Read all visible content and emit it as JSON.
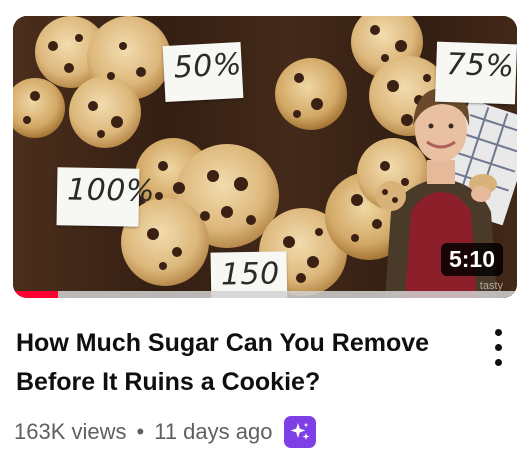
{
  "video": {
    "duration": "5:10",
    "watch_progress": 0.09,
    "watermark": "tasty",
    "signs": {
      "s50": "50%",
      "s75": "75%",
      "s100": "100%",
      "s150": "150"
    },
    "title": "How Much Sugar Can You Remove Before It Ruins a Cookie?",
    "views": "163K views",
    "separator": "•",
    "age": "11 days ago"
  },
  "colors": {
    "progress": "#ff0033",
    "badge": "#7e3fe6",
    "meta_text": "#606060",
    "title_text": "#0f0f0f"
  },
  "icons": {
    "menu": "more-vert-icon",
    "badge": "sparkle-icon"
  }
}
